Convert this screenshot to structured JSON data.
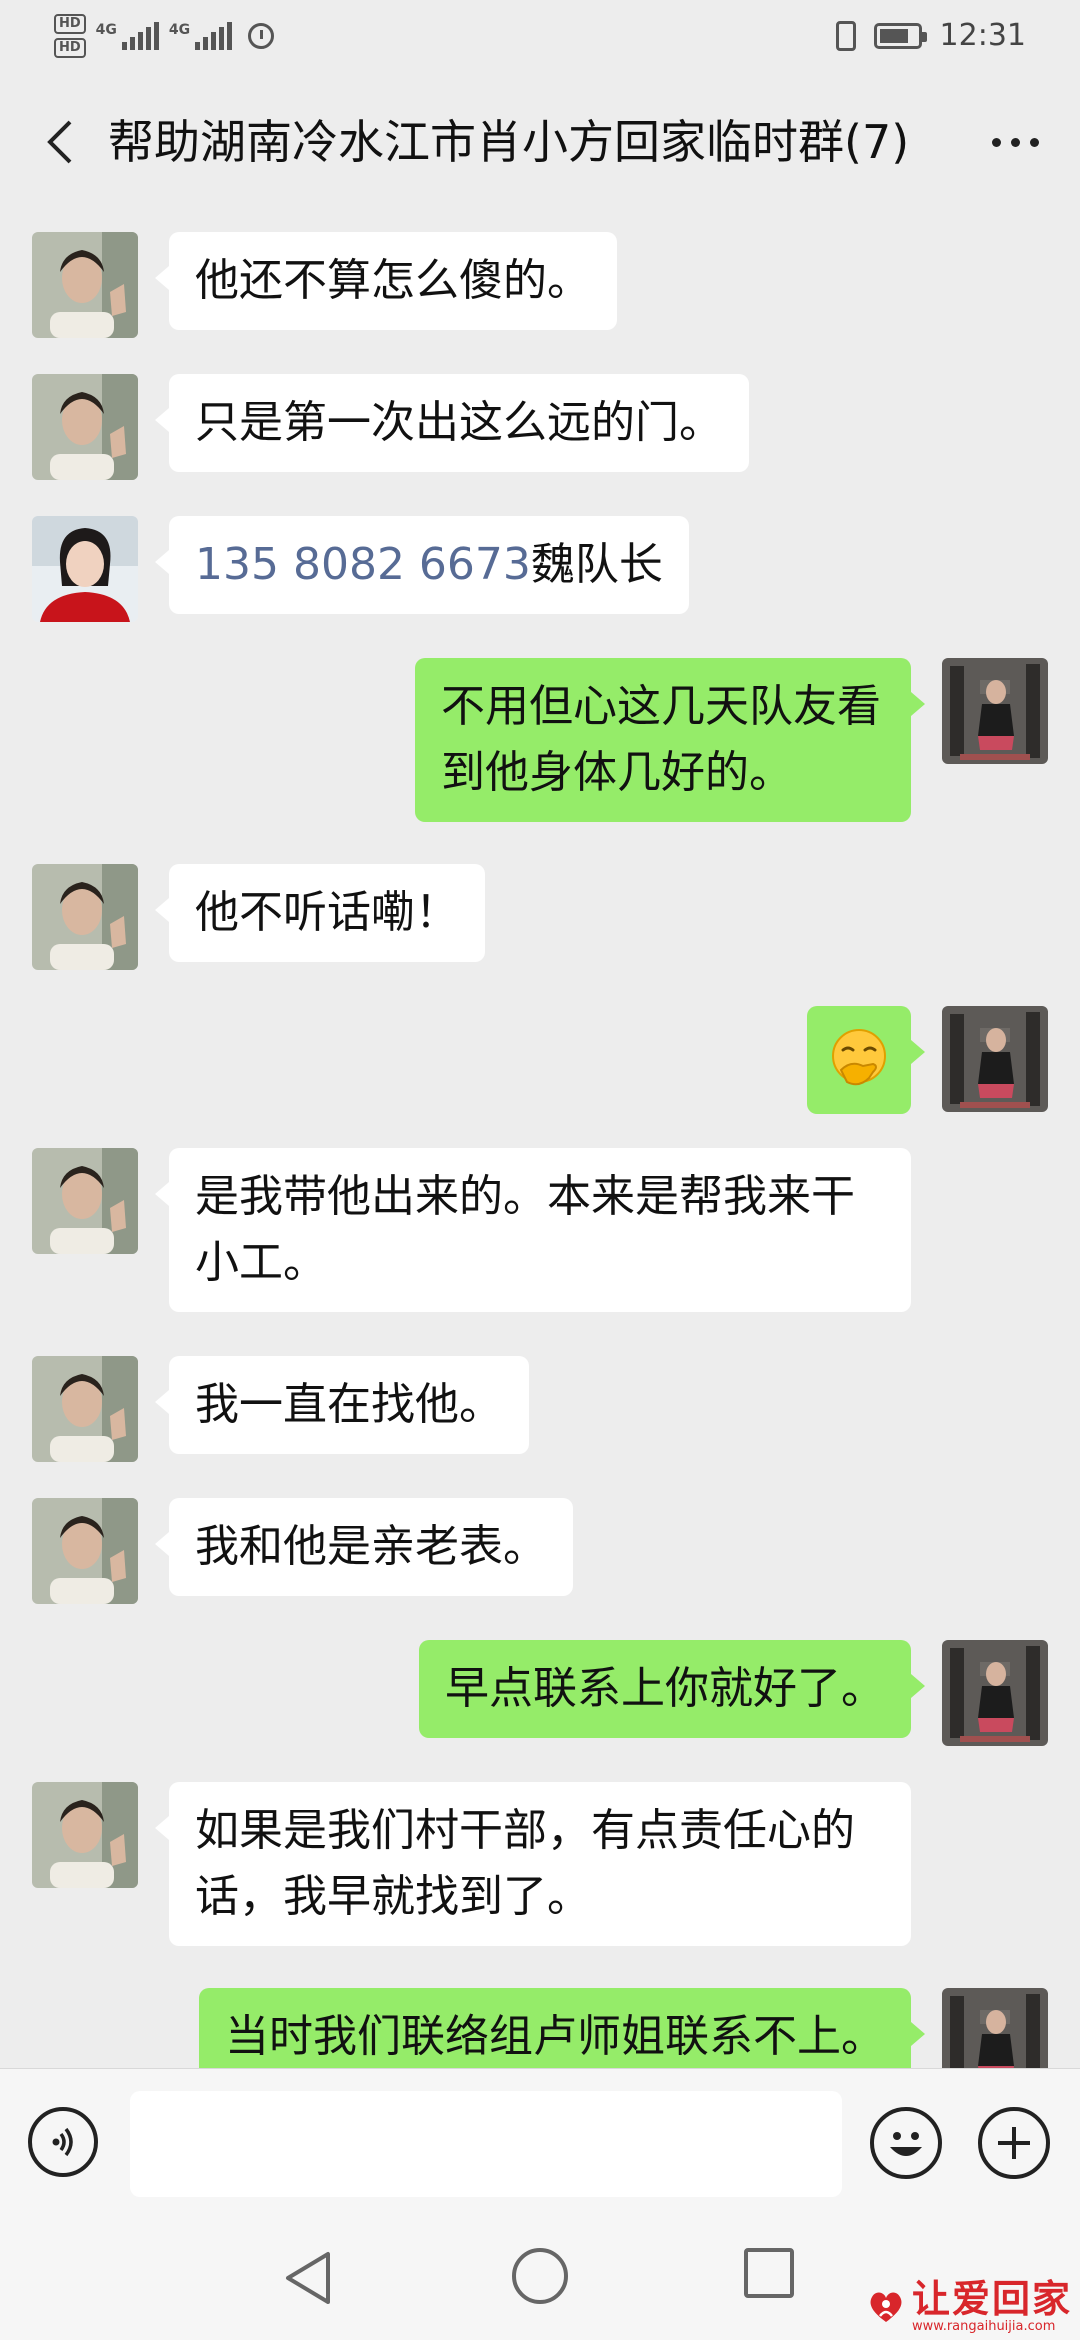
{
  "status_bar": {
    "hd1": "HD",
    "hd2": "HD",
    "net1": "4G",
    "net2": "4G",
    "time": "12:31"
  },
  "header": {
    "title": "帮助湖南冷水江市肖小方回家临时群(7)",
    "back_icon": "chevron-left-icon",
    "more_icon": "more-dots-icon"
  },
  "colors": {
    "background": "#ededed",
    "incoming_bubble": "#ffffff",
    "outgoing_bubble": "#95ec69",
    "phone_link": "#576b95",
    "watermark": "#d8262b"
  },
  "messages": [
    {
      "dir": "in",
      "avatar": "avatar-relative",
      "text": "他还不算怎么傻的。"
    },
    {
      "dir": "in",
      "avatar": "avatar-relative",
      "text": "只是第一次出这么远的门。"
    },
    {
      "dir": "in",
      "avatar": "avatar-woman",
      "phone": "135 8082 6673",
      "text": "魏队长"
    },
    {
      "dir": "out",
      "avatar": "avatar-self",
      "text": "不用但心这几天队友看到他身体几好的。"
    },
    {
      "dir": "in",
      "avatar": "avatar-relative",
      "text": "他不听话嘞！"
    },
    {
      "dir": "out",
      "avatar": "avatar-self",
      "emoji": "🤭"
    },
    {
      "dir": "in",
      "avatar": "avatar-relative",
      "text": "是我带他出来的。本来是帮我来干小工。"
    },
    {
      "dir": "in",
      "avatar": "avatar-relative",
      "text": "我一直在找他。"
    },
    {
      "dir": "in",
      "avatar": "avatar-relative",
      "text": "我和他是亲老表。"
    },
    {
      "dir": "out",
      "avatar": "avatar-self",
      "text": "早点联系上你就好了。"
    },
    {
      "dir": "in",
      "avatar": "avatar-relative",
      "text": "如果是我们村干部，有点责任心的话，我早就找到了。"
    },
    {
      "dir": "out",
      "avatar": "avatar-self",
      "text": "当时我们联络组卢师姐联系不上。"
    }
  ],
  "input_bar": {
    "voice_icon": "voice-icon",
    "emoji_icon": "emoji-icon",
    "plus_icon": "plus-icon"
  },
  "watermark": {
    "text": "让爱回家",
    "url": "www.rangaihuijia.com"
  }
}
